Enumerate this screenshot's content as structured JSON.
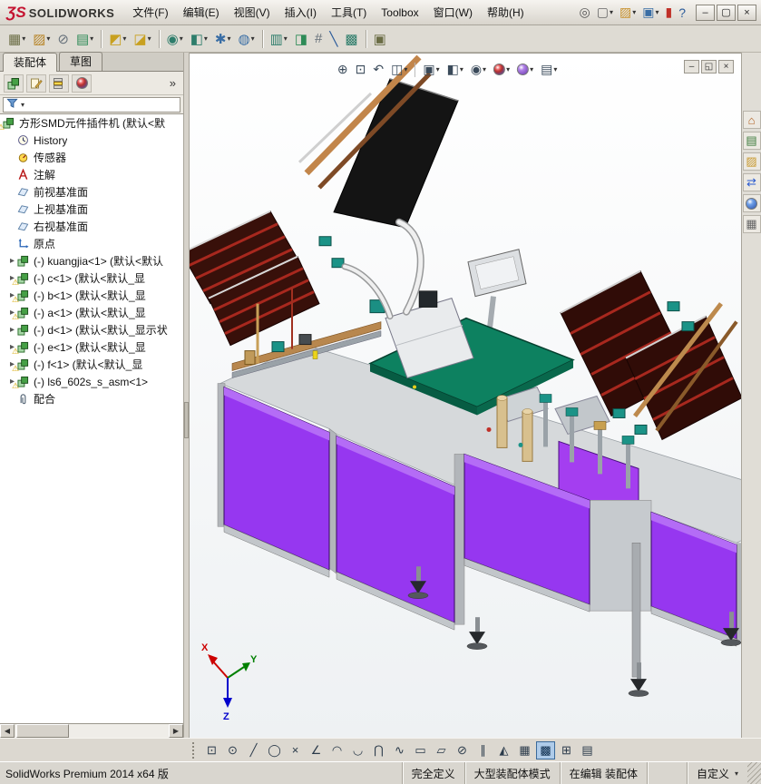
{
  "titlebar": {
    "logo_mark": "ƷS",
    "logo_text": "SOLIDWORKS",
    "menus": [
      "文件(F)",
      "编辑(E)",
      "视图(V)",
      "插入(I)",
      "工具(T)",
      "Toolbox",
      "窗口(W)",
      "帮助(H)"
    ],
    "quick_buttons": [
      {
        "name": "search",
        "glyph": "◎",
        "color": "#555"
      },
      {
        "name": "new-document",
        "glyph": "▢",
        "color": "#666",
        "caret": true
      },
      {
        "name": "open-document",
        "glyph": "▨",
        "color": "#c8922e",
        "caret": true
      },
      {
        "name": "save-document",
        "glyph": "▣",
        "color": "#3a6ea5",
        "caret": true
      },
      {
        "name": "solidworks-resources",
        "glyph": "▮",
        "color": "#c03028"
      },
      {
        "name": "help",
        "glyph": "?",
        "color": "#2a5a9a"
      }
    ],
    "window_controls": [
      {
        "name": "minimize",
        "glyph": "–"
      },
      {
        "name": "maximize",
        "glyph": "▢"
      },
      {
        "name": "close",
        "glyph": "×"
      }
    ]
  },
  "toolbar": {
    "buttons": [
      {
        "name": "edit-assembly",
        "glyph": "▦",
        "color": "#6b6d45",
        "caret": true
      },
      {
        "name": "insert-components",
        "glyph": "▨",
        "color": "#b8862a",
        "caret": true
      },
      {
        "name": "attachments",
        "glyph": "⊘",
        "color": "#66707a"
      },
      {
        "name": "mate",
        "glyph": "▤",
        "color": "#2e8b57",
        "caret": true
      },
      {
        "sep": true
      },
      {
        "name": "component-pattern",
        "glyph": "◩",
        "color": "#c8a020",
        "caret": true
      },
      {
        "name": "smart-fasteners",
        "glyph": "◪",
        "color": "#c8a020",
        "caret": true
      },
      {
        "sep": true
      },
      {
        "name": "move-component",
        "glyph": "◉",
        "color": "#2e7d6b",
        "caret": true
      },
      {
        "name": "show-hidden-components",
        "glyph": "◧",
        "color": "#2e7d6b",
        "caret": true
      },
      {
        "name": "assembly-features",
        "glyph": "✱",
        "color": "#3a6ea5",
        "caret": true
      },
      {
        "name": "reference-geometry",
        "glyph": "◍",
        "color": "#3a6ea5",
        "caret": true
      },
      {
        "sep": true
      },
      {
        "name": "bill-of-materials",
        "glyph": "▥",
        "color": "#2e7d6b",
        "caret": true
      },
      {
        "name": "exploded-view",
        "glyph": "◨",
        "color": "#2e8b57"
      },
      {
        "name": "interference-detection",
        "glyph": "#",
        "color": "#66707a"
      },
      {
        "name": "measure",
        "glyph": "╲",
        "color": "#2a5a9a"
      },
      {
        "name": "mass-properties",
        "glyph": "▩",
        "color": "#2e7d6b"
      },
      {
        "sep": true
      },
      {
        "name": "instant-3d",
        "glyph": "▣",
        "color": "#6b6d45"
      }
    ]
  },
  "left_panel": {
    "tabs": [
      {
        "label": "装配体",
        "active": true
      },
      {
        "label": "草图",
        "active": false
      }
    ],
    "overflow": "»",
    "scrollbar": {
      "left": "◀",
      "right": "▶"
    },
    "tree": [
      {
        "icon": "assembly",
        "warn": true,
        "level": 0,
        "label": "方形SMD元件插件机 (默认<默"
      },
      {
        "icon": "history",
        "level": 1,
        "label": "History"
      },
      {
        "icon": "sensors",
        "level": 1,
        "label": "传感器"
      },
      {
        "icon": "annotations",
        "level": 1,
        "label": "注解"
      },
      {
        "icon": "plane",
        "level": 1,
        "label": "前视基准面"
      },
      {
        "icon": "plane",
        "level": 1,
        "label": "上视基准面"
      },
      {
        "icon": "plane",
        "level": 1,
        "label": "右视基准面"
      },
      {
        "icon": "origin",
        "level": 1,
        "label": "原点"
      },
      {
        "icon": "component",
        "expand": true,
        "level": 1,
        "label": "(-) kuangjia<1> (默认<默认"
      },
      {
        "icon": "component",
        "expand": true,
        "warn": true,
        "level": 1,
        "label": "(-) c<1> (默认<默认_显"
      },
      {
        "icon": "component",
        "expand": true,
        "warn": true,
        "level": 1,
        "label": "(-) b<1> (默认<默认_显"
      },
      {
        "icon": "component",
        "expand": true,
        "warn": true,
        "level": 1,
        "label": "(-) a<1> (默认<默认_显"
      },
      {
        "icon": "component",
        "expand": true,
        "level": 1,
        "label": "(-) d<1> (默认<默认_显示状"
      },
      {
        "icon": "component",
        "expand": true,
        "warn": true,
        "level": 1,
        "label": "(-) e<1> (默认<默认_显"
      },
      {
        "icon": "component",
        "expand": true,
        "warn": true,
        "level": 1,
        "label": "(-) f<1> (默认<默认_显"
      },
      {
        "icon": "component",
        "expand": true,
        "warn": true,
        "level": 1,
        "label": "(-) ls6_602s_s_asm<1>"
      },
      {
        "icon": "mates",
        "level": 1,
        "label": "配合"
      }
    ]
  },
  "viewport": {
    "hud": [
      {
        "name": "zoom-to-fit",
        "glyph": "⊕"
      },
      {
        "name": "zoom-to-area",
        "glyph": "⊡"
      },
      {
        "name": "previous-view",
        "glyph": "↶"
      },
      {
        "name": "section-view",
        "glyph": "◫",
        "caret": true
      },
      {
        "sep": true
      },
      {
        "name": "view-orientation",
        "glyph": "▣",
        "caret": true
      },
      {
        "name": "display-style",
        "glyph": "◧",
        "caret": true
      },
      {
        "name": "hide-show-items",
        "glyph": "◉",
        "caret": true
      },
      {
        "name": "edit-appearance",
        "ball": "rb",
        "caret": true
      },
      {
        "name": "apply-scene",
        "ball": "purple",
        "caret": true
      },
      {
        "name": "view-settings",
        "glyph": "▤",
        "caret": true
      }
    ],
    "doc_controls": [
      {
        "name": "document-minimize",
        "glyph": "–"
      },
      {
        "name": "document-restore",
        "glyph": "◱"
      },
      {
        "name": "document-close",
        "glyph": "×"
      }
    ],
    "triad": {
      "x": "X",
      "y": "Y",
      "z": "Z"
    }
  },
  "task_pane": {
    "icons": [
      {
        "name": "solidworks-resources-tab",
        "glyph": "⌂",
        "color": "#b06020"
      },
      {
        "name": "design-library-tab",
        "glyph": "▤",
        "color": "#3a7a3a"
      },
      {
        "name": "file-explorer-tab",
        "glyph": "▨",
        "color": "#c89a30"
      },
      {
        "name": "view-palette-tab",
        "glyph": "⇄",
        "color": "#2a5ad0"
      },
      {
        "name": "appearances-scenes-tab",
        "ball": "blue"
      },
      {
        "name": "custom-properties-tab",
        "glyph": "▦",
        "color": "#666"
      }
    ]
  },
  "sketch_toolbar": {
    "buttons": [
      {
        "name": "point-tool",
        "glyph": "⊡"
      },
      {
        "name": "circle-tool",
        "glyph": "⊙"
      },
      {
        "name": "line-tool",
        "glyph": "╱"
      },
      {
        "name": "ellipse-tool",
        "glyph": "◯"
      },
      {
        "name": "erase-tool",
        "glyph": "×"
      },
      {
        "name": "angle-line-tool",
        "glyph": "∠"
      },
      {
        "name": "centerpoint-arc-tool",
        "glyph": "◠"
      },
      {
        "name": "tangent-arc-tool",
        "glyph": "◡"
      },
      {
        "name": "three-point-arc-tool",
        "glyph": "⋂"
      },
      {
        "name": "spline-tool",
        "glyph": "∿"
      },
      {
        "name": "rectangle-tool",
        "glyph": "▭"
      },
      {
        "name": "parallelogram-tool",
        "glyph": "▱"
      },
      {
        "name": "trim-tool",
        "glyph": "⊘"
      },
      {
        "name": "offset-tool",
        "glyph": "∥"
      },
      {
        "name": "mirror-tool",
        "glyph": "◭"
      },
      {
        "name": "linear-pattern-tool",
        "glyph": "▦"
      },
      {
        "name": "grid-view-tool",
        "glyph": "▩",
        "active": true
      },
      {
        "name": "table-tool",
        "glyph": "⊞"
      },
      {
        "name": "sheet-tool",
        "glyph": "▤"
      }
    ]
  },
  "statusbar": {
    "product": "SolidWorks Premium 2014 x64 版",
    "define_status": "完全定义",
    "assembly_mode": "大型装配体模式",
    "editing_status": "在编辑 装配体",
    "custom_label": "自定义"
  },
  "model": {
    "colors": {
      "panel_purple": "#9637f0",
      "table_green": "#0d8160",
      "rack_dark": "#38100a",
      "rack_stripe": "#a8281e",
      "rail_tan": "#c2854a",
      "frame_gray": "#c6cace"
    }
  }
}
